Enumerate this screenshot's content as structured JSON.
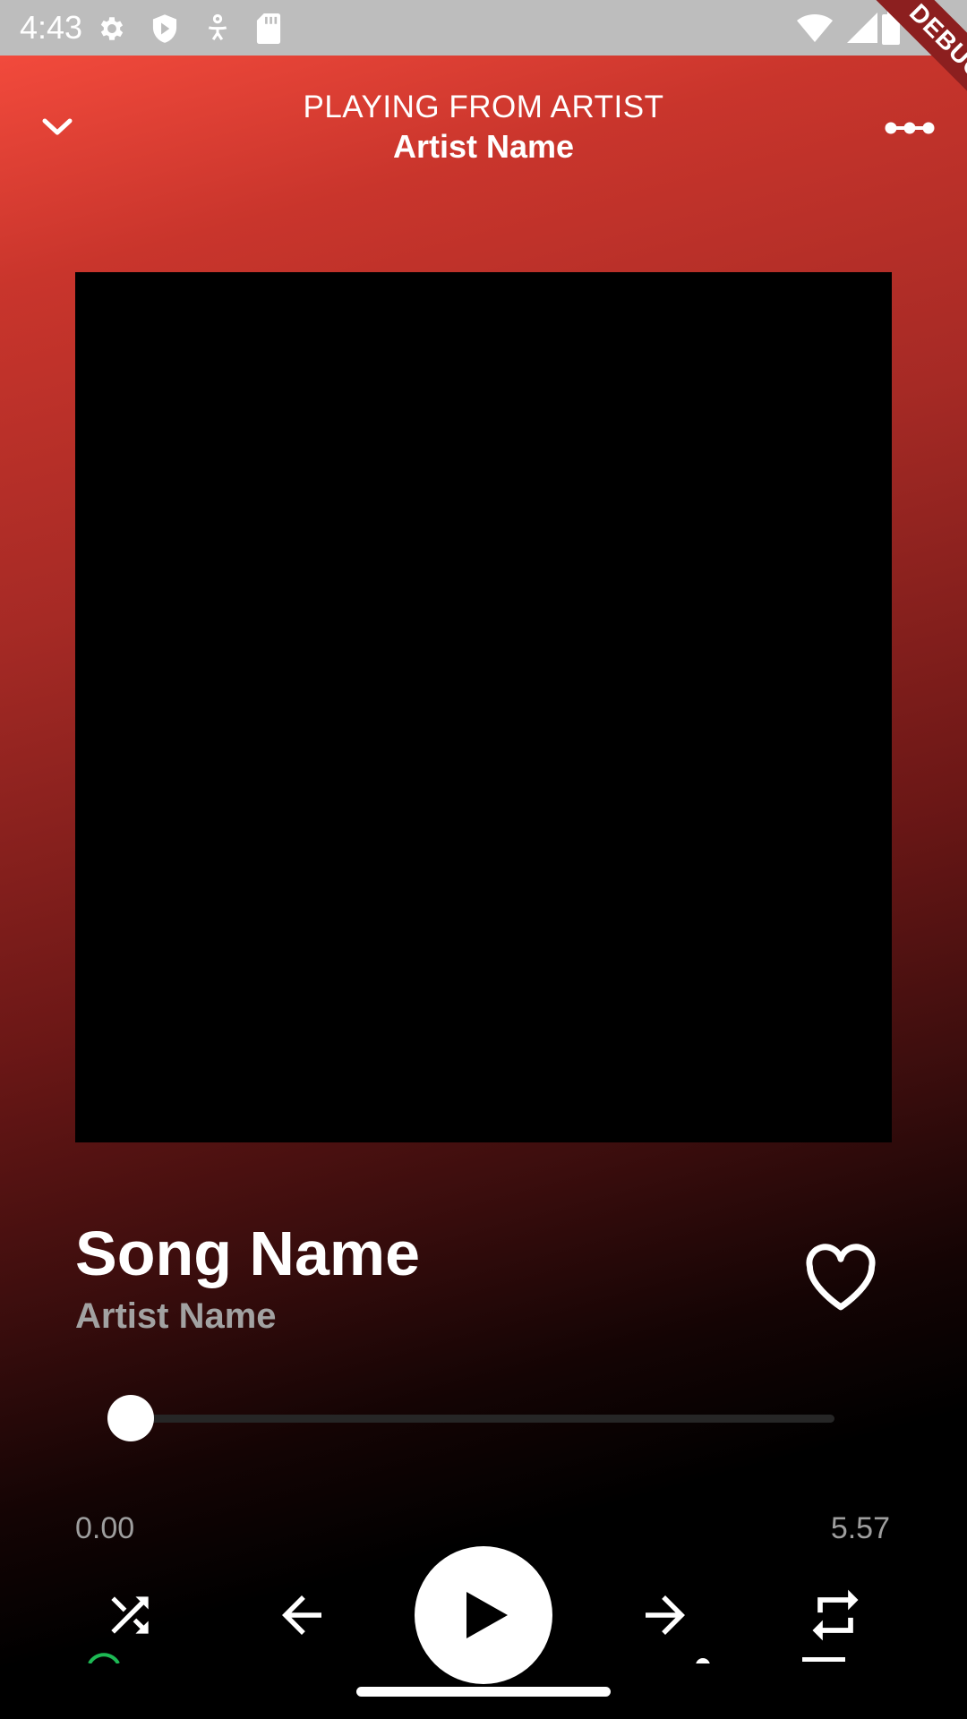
{
  "status_bar": {
    "time": "4:43",
    "icons": [
      "settings-icon",
      "shield-icon",
      "accessibility-icon",
      "sd-card-icon",
      "wifi-icon",
      "cell-signal-icon",
      "battery-icon"
    ]
  },
  "debug_banner": "DEBUG",
  "header": {
    "subtitle": "PLAYING FROM ARTIST",
    "title": "Artist Name",
    "left_icon": "chevron-down-icon",
    "right_icon": "more-options-icon"
  },
  "track": {
    "title": "Song Name",
    "artist": "Artist Name",
    "liked": false
  },
  "progress": {
    "elapsed": "0.00",
    "total": "5.57",
    "fraction": 0.0
  },
  "controls": [
    "shuffle-icon",
    "previous-icon",
    "play-icon",
    "next-icon",
    "repeat-icon"
  ],
  "colors": {
    "gradient_top": "#f24a3c",
    "background_bottom": "#000000",
    "secondary_text": "#a2a2a2",
    "track": "#262626"
  }
}
